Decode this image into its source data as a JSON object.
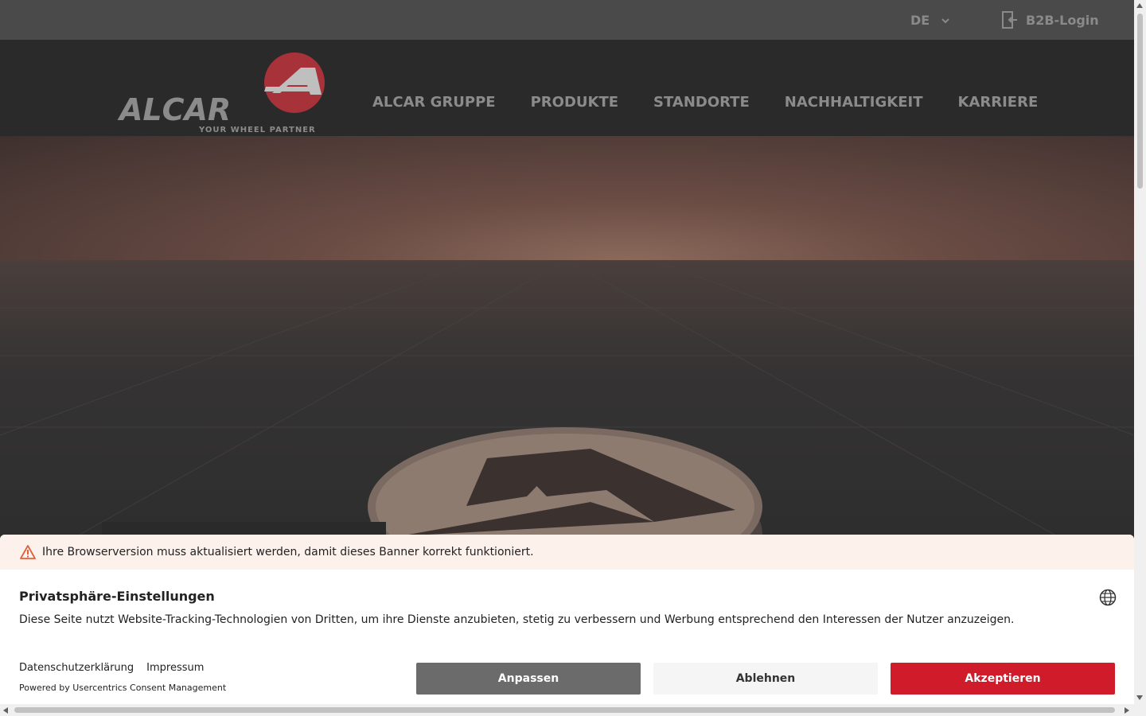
{
  "topbar": {
    "language": "DE",
    "b2b_login": "B2B-Login"
  },
  "logo": {
    "brand": "ALCAR",
    "tagline": "YOUR WHEEL PARTNER"
  },
  "nav": {
    "items": [
      "ALCAR GRUPPE",
      "PRODUKTE",
      "STANDORTE",
      "NACHHALTIGKEIT",
      "KARRIERE"
    ]
  },
  "banner": {
    "warning": "Ihre Browserversion muss aktualisiert werden, damit dieses Banner korrekt funktioniert.",
    "title": "Privatsphäre-Einstellungen",
    "description": "Diese Seite nutzt Website-Tracking-Technologien von Dritten, um ihre Dienste anzubieten, stetig zu verbessern und Werbung entsprechend den Interessen der Nutzer anzuzeigen.",
    "link_privacy": "Datenschutzerklärung",
    "link_imprint": "Impressum",
    "powered_by": "Powered by Usercentrics Consent Management",
    "btn_customize": "Anpassen",
    "btn_deny": "Ablehnen",
    "btn_accept": "Akzeptieren"
  },
  "colors": {
    "accent": "#d01c2a",
    "logo_red": "#a8323a"
  }
}
